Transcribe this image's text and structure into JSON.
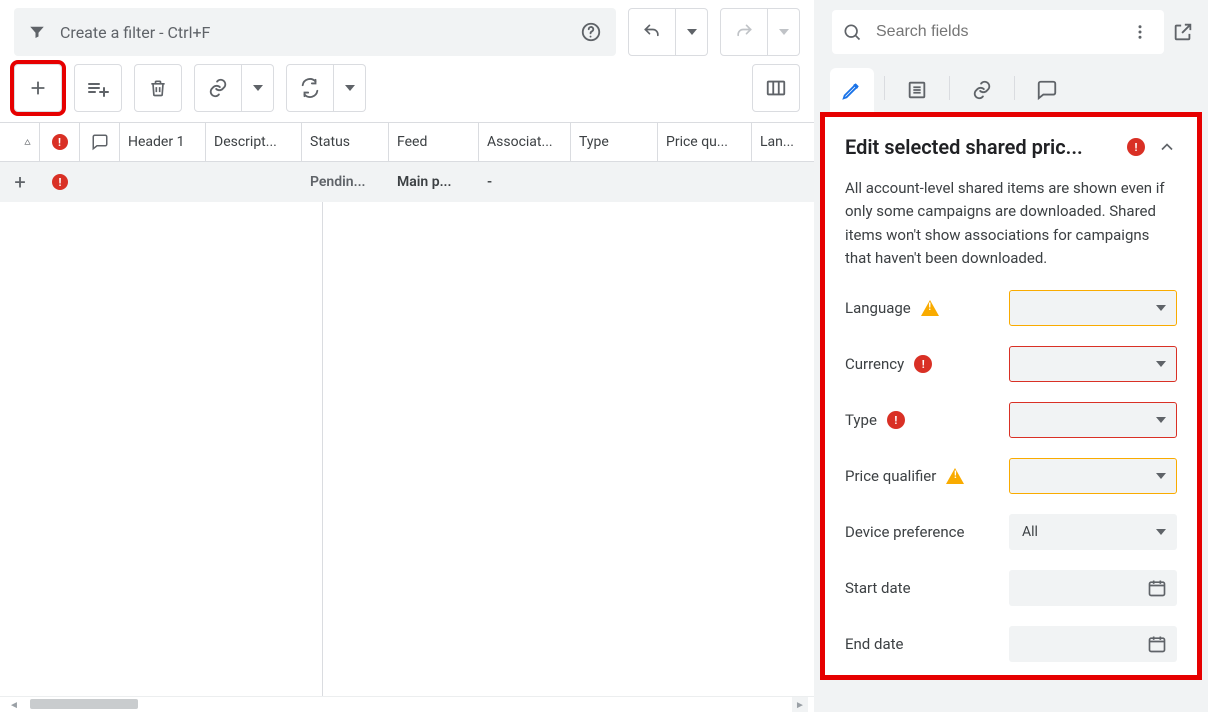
{
  "filter": {
    "placeholder": "Create a filter - Ctrl+F"
  },
  "search": {
    "placeholder": "Search fields"
  },
  "grid": {
    "columns": [
      "Header 1",
      "Descript...",
      "Status",
      "Feed",
      "Associat...",
      "Type",
      "Price qu...",
      "Lan..."
    ],
    "row": {
      "status": "Pendin...",
      "feed": "Main p...",
      "assoc": "-"
    }
  },
  "panel": {
    "title": "Edit selected shared pric...",
    "description": "All account-level shared items are shown even if only some campaigns are downloaded. Shared items won't show associations for campaigns that haven't been downloaded.",
    "fields": {
      "language": {
        "label": "Language",
        "state": "warn",
        "value": ""
      },
      "currency": {
        "label": "Currency",
        "state": "err",
        "value": ""
      },
      "type": {
        "label": "Type",
        "state": "err",
        "value": ""
      },
      "price_qualifier": {
        "label": "Price qualifier",
        "state": "warn",
        "value": ""
      },
      "device_preference": {
        "label": "Device preference",
        "state": "none",
        "value": "All"
      },
      "start_date": {
        "label": "Start date"
      },
      "end_date": {
        "label": "End date"
      }
    }
  }
}
